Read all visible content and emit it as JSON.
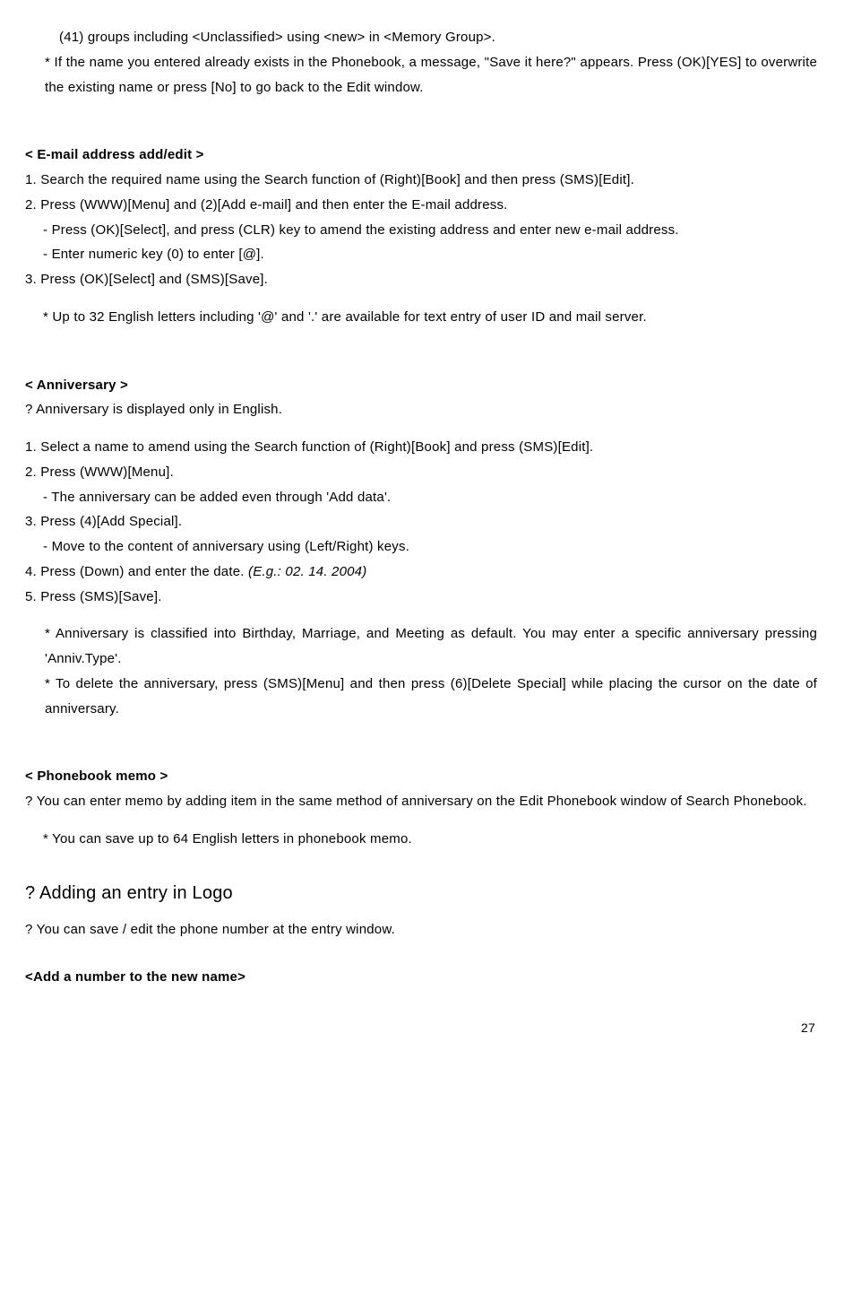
{
  "line1": "(41) groups including <Unclassified> using <new> in <Memory Group>.",
  "line2": "* If the name you entered already exists in the Phonebook, a message, \"Save it here?\" appears. Press (OK)[YES] to overwrite the existing name or press [No] to go back to the Edit window.",
  "email_head": "< E-mail address add/edit >",
  "email_1": "1. Search the required name using the Search function of (Right)[Book] and then press (SMS)[Edit].",
  "email_2": "2. Press (WWW)[Menu] and (2)[Add e-mail] and then enter the E-mail address.",
  "email_2a": "- Press (OK)[Select], and press (CLR) key to amend the existing address and enter new e-mail address.",
  "email_2b": "- Enter numeric key (0) to enter [@].",
  "email_3": "3. Press (OK)[Select] and (SMS)[Save].",
  "email_note": "* Up to 32 English letters including '@' and '.' are available for text entry of user ID and mail server.",
  "anniv_head": "< Anniversary >",
  "anniv_intro": "?   Anniversary is displayed only in English.",
  "anniv_1": "1. Select a name to amend using the Search function of (Right)[Book] and press (SMS)[Edit].",
  "anniv_2": "2. Press (WWW)[Menu].",
  "anniv_2a": "- The anniversary can be added even through 'Add data'.",
  "anniv_3": "3. Press (4)[Add Special].",
  "anniv_3a": "- Move to the content of anniversary using (Left/Right) keys.",
  "anniv_4_pre": "4. Press (Down) and enter the date.  ",
  "anniv_4_eg": "(E.g.: 02. 14. 2004)",
  "anniv_5": "5. Press (SMS)[Save].",
  "anniv_note1": "* Anniversary is classified into Birthday, Marriage, and Meeting as default. You may enter a specific anniversary pressing 'Anniv.Type'.",
  "anniv_note2": "* To delete the anniversary, press (SMS)[Menu] and then press (6)[Delete Special] while placing the cursor on the date of anniversary.",
  "memo_head": "< Phonebook memo >",
  "memo_intro": "?    You can enter memo by adding item in the same method of anniversary on the Edit Phonebook window of Search Phonebook.",
  "memo_note": "* You can save up to 64 English letters in phonebook memo.",
  "logo_head": "?   Adding an entry in Logo",
  "logo_intro": "?    You can save / edit the phone number at the entry window.",
  "add_num_head": "<Add a number to the new name>",
  "page_number": "27"
}
